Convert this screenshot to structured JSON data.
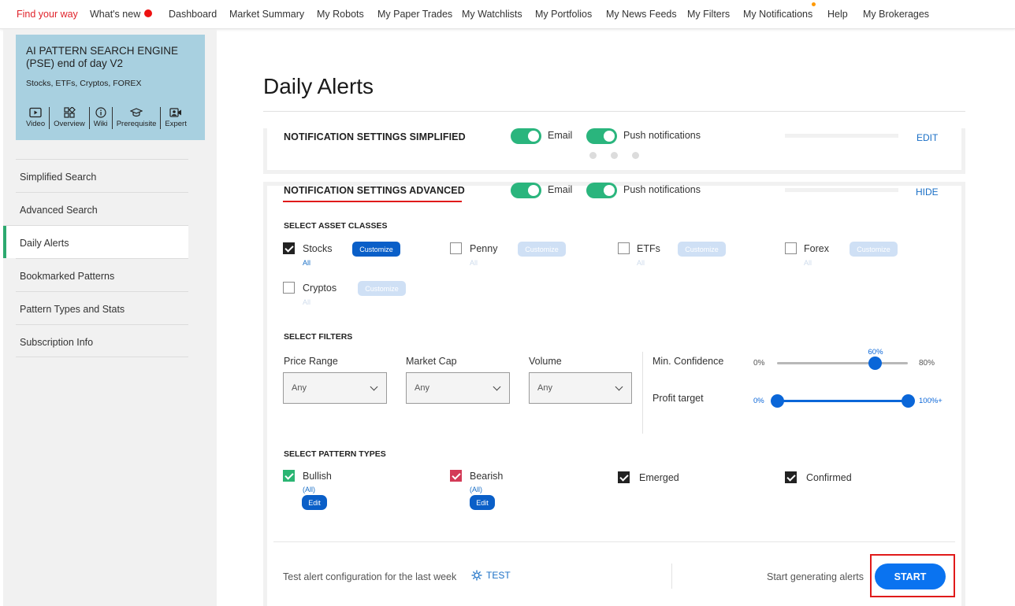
{
  "nav": {
    "items": [
      {
        "label": "Find your way"
      },
      {
        "label": "What's new"
      },
      {
        "label": "Dashboard"
      },
      {
        "label": "Market Summary"
      },
      {
        "label": "My Robots"
      },
      {
        "label": "My Paper Trades"
      },
      {
        "label": "My Watchlists"
      },
      {
        "label": "My Portfolios"
      },
      {
        "label": "My News Feeds"
      },
      {
        "label": "My Filters"
      },
      {
        "label": "My Notifications"
      },
      {
        "label": "Help"
      },
      {
        "label": "My Brokerages"
      }
    ],
    "colors": {
      "accent": "#e0232b",
      "new_dot": "#ee1111",
      "notification_dot": "#ff9900"
    }
  },
  "sidebar": {
    "card": {
      "title": "AI PATTERN SEARCH ENGINE (PSE) end of day V2",
      "subtitle": "Stocks, ETFs, Cryptos, FOREX",
      "links": [
        {
          "label": "Video",
          "icon": "video-icon"
        },
        {
          "label": "Overview",
          "icon": "overview-icon"
        },
        {
          "label": "Wiki",
          "icon": "info-icon"
        },
        {
          "label": "Prerequisite",
          "icon": "graduation-cap-icon"
        },
        {
          "label": "Expert",
          "icon": "expert-video-icon"
        }
      ]
    },
    "menu": [
      {
        "label": "Simplified Search"
      },
      {
        "label": "Advanced Search"
      },
      {
        "label": "Daily Alerts",
        "active": true
      },
      {
        "label": "Bookmarked Patterns"
      },
      {
        "label": "Pattern Types and Stats"
      },
      {
        "label": "Subscription Info"
      }
    ],
    "active_color": "#2ca96f"
  },
  "main": {
    "title": "Daily Alerts",
    "simplified": {
      "heading": "NOTIFICATION SETTINGS SIMPLIFIED",
      "email_label": "Email",
      "email_on": true,
      "push_label": "Push notifications",
      "push_on": true,
      "action": "EDIT"
    },
    "advanced": {
      "heading": "NOTIFICATION SETTINGS ADVANCED",
      "email_label": "Email",
      "email_on": true,
      "push_label": "Push notifications",
      "push_on": true,
      "action": "HIDE",
      "asset_classes": {
        "heading": "SELECT ASSET CLASSES",
        "items": [
          {
            "label": "Stocks",
            "checked": true,
            "sub": "All",
            "button": "Customize"
          },
          {
            "label": "Penny",
            "checked": false,
            "sub": "All",
            "button": "Customize"
          },
          {
            "label": "ETFs",
            "checked": false,
            "sub": "All",
            "button": "Customize"
          },
          {
            "label": "Forex",
            "checked": false,
            "sub": "All",
            "button": "Customize"
          },
          {
            "label": "Cryptos",
            "checked": false,
            "sub": "All",
            "button": "Customize"
          }
        ]
      },
      "filters": {
        "heading": "SELECT FILTERS",
        "price_range": {
          "label": "Price Range",
          "value": "Any"
        },
        "market_cap": {
          "label": "Market Cap",
          "value": "Any"
        },
        "volume": {
          "label": "Volume",
          "value": "Any"
        },
        "min_confidence": {
          "label": "Min. Confidence",
          "min_label": "0%",
          "max_label": "80%",
          "value_label": "60%",
          "value_fraction": 0.75
        },
        "profit_target": {
          "label": "Profit target",
          "min_label": "0%",
          "max_label": "100%+",
          "low_fraction": 0.0,
          "high_fraction": 1.0
        }
      },
      "pattern_types": {
        "heading": "SELECT PATTERN TYPES",
        "items": [
          {
            "label": "Bullish",
            "checked": true,
            "sub": "(All)",
            "button": "Edit",
            "color": "#2bb573"
          },
          {
            "label": "Bearish",
            "checked": true,
            "sub": "(All)",
            "button": "Edit",
            "color": "#d33a57"
          },
          {
            "label": "Emerged",
            "checked": true
          },
          {
            "label": "Confirmed",
            "checked": true
          }
        ]
      },
      "footer": {
        "test_text": "Test alert configuration for the last week",
        "test_link": "TEST",
        "start_text": "Start generating alerts",
        "start_button": "START"
      }
    }
  }
}
